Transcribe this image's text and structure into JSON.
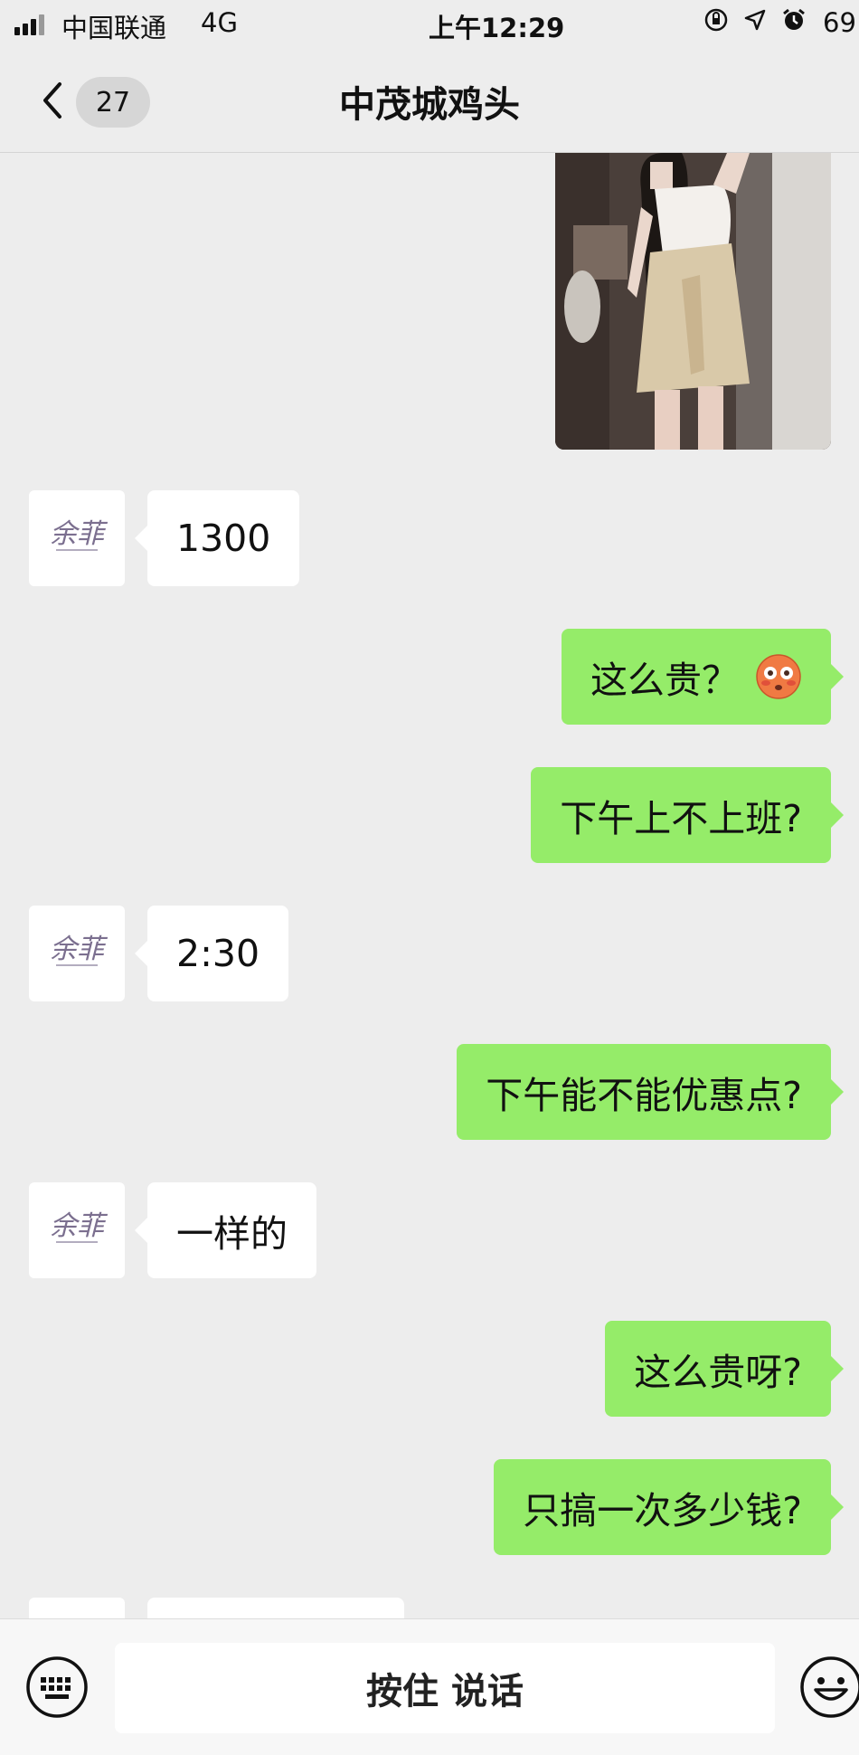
{
  "status_bar": {
    "carrier": "中国联通",
    "network": "4G",
    "time": "上午12:29",
    "battery": "69"
  },
  "header": {
    "back_badge": "27",
    "title": "中茂城鸡头"
  },
  "messages": [
    {
      "side": "in",
      "text": "1300"
    },
    {
      "side": "out",
      "text": "这么贵？"
    },
    {
      "side": "out",
      "text": "下午上不上班?"
    },
    {
      "side": "in",
      "text": "2:30"
    },
    {
      "side": "out",
      "text": "下午能不能优惠点?"
    },
    {
      "side": "in",
      "text": "一样的"
    },
    {
      "side": "out",
      "text": "这么贵呀?"
    },
    {
      "side": "out",
      "text": "只搞一次多少钱?"
    }
  ],
  "avatar_logo_text": "余菲",
  "input_bar": {
    "hold_to_talk": "按住 说话"
  },
  "colors": {
    "background": "#ededed",
    "bubble_out": "#95ec69",
    "bubble_in": "#ffffff",
    "input_bar": "#f7f7f7"
  },
  "icons": [
    "signal-icon",
    "orientation-lock-icon",
    "location-icon",
    "alarm-icon",
    "back-chevron-icon",
    "keyboard-icon",
    "emoji-icon",
    "flushed-face-emoji"
  ]
}
